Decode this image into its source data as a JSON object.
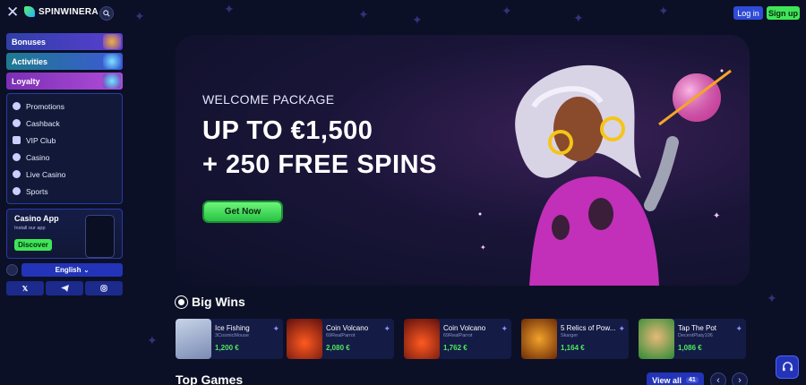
{
  "header": {
    "brand": "SPINWINERA",
    "login_label": "Log in",
    "signup_label": "Sign up"
  },
  "sidebar": {
    "categories": [
      {
        "label": "Bonuses"
      },
      {
        "label": "Activities"
      },
      {
        "label": "Loyalty"
      }
    ],
    "menu": [
      {
        "label": "Promotions",
        "icon": "promotions-icon"
      },
      {
        "label": "Cashback",
        "icon": "cashback-icon"
      },
      {
        "label": "VIP Club",
        "icon": "crown-icon"
      },
      {
        "label": "Casino",
        "icon": "casino-chip-icon"
      },
      {
        "label": "Live Casino",
        "icon": "live-casino-icon"
      },
      {
        "label": "Sports",
        "icon": "sports-ball-icon"
      }
    ],
    "app_promo": {
      "title": "Casino App",
      "subtitle": "Install our app",
      "cta": "Discover"
    },
    "language": "English",
    "socials": [
      "x-icon",
      "telegram-icon",
      "instagram-icon"
    ]
  },
  "hero": {
    "eyebrow": "WELCOME PACKAGE",
    "line1": "UP TO €1,500",
    "line2": "+ 250 FREE SPINS",
    "cta": "Get Now"
  },
  "big_wins": {
    "heading": "Big Wins",
    "items": [
      {
        "game": "Ice Fishing",
        "player": "3CosmicMouse",
        "amount": "1,200 €"
      },
      {
        "game": "Coin Volcano",
        "player": "69RealParrot",
        "amount": "2,080 €"
      },
      {
        "game": "Coin Volcano",
        "player": "69RealParrot",
        "amount": "1,762 €"
      },
      {
        "game": "5 Relics of Pow...",
        "player": "Skarger",
        "amount": "1,164 €"
      },
      {
        "game": "Tap The Pot",
        "player": "DecentPlaty106",
        "amount": "1,086 €"
      }
    ]
  },
  "top_games": {
    "heading": "Top Games",
    "view_all": "View all",
    "count": "41"
  },
  "colors": {
    "background": "#0b1026",
    "accent_green": "#3ee657",
    "accent_blue": "#2334b8"
  }
}
